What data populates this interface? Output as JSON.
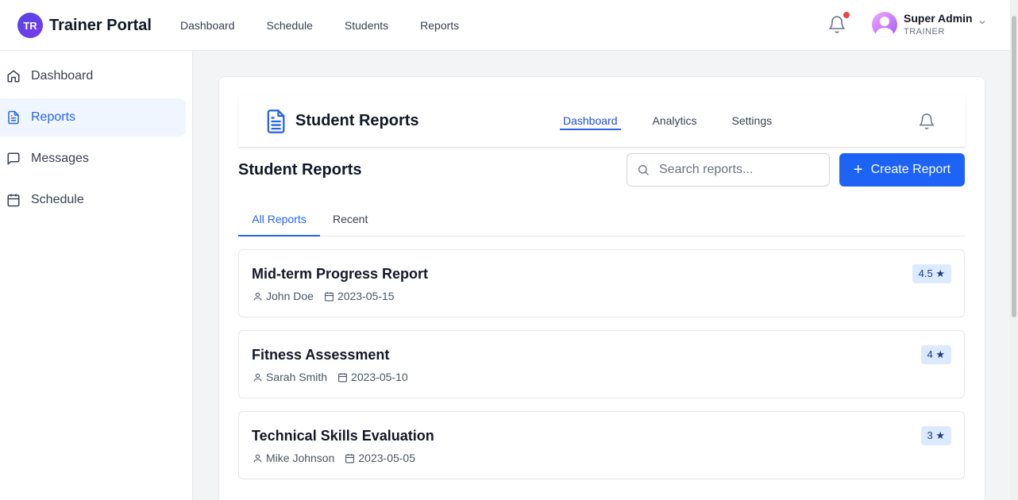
{
  "app": {
    "badge": "TR",
    "title": "Trainer Portal"
  },
  "topnav": [
    "Dashboard",
    "Schedule",
    "Students",
    "Reports"
  ],
  "user": {
    "name": "Super Admin",
    "role": "TRAINER"
  },
  "sidebar": {
    "items": [
      {
        "label": "Dashboard",
        "icon": "home-icon"
      },
      {
        "label": "Reports",
        "icon": "document-icon",
        "active": true
      },
      {
        "label": "Messages",
        "icon": "message-icon"
      },
      {
        "label": "Schedule",
        "icon": "calendar-icon"
      }
    ]
  },
  "inner_header": {
    "title": "Student Reports",
    "nav": [
      "Dashboard",
      "Analytics",
      "Settings"
    ],
    "active_nav": "Dashboard"
  },
  "page": {
    "title": "Student Reports",
    "search_placeholder": "Search reports...",
    "search_value": "",
    "create_plus": "+",
    "create_label": "Create Report"
  },
  "tabs": {
    "all": "All Reports",
    "recent": "Recent",
    "active": "All Reports"
  },
  "reports": [
    {
      "title": "Mid-term Progress Report",
      "student": "John Doe",
      "date": "2023-05-15",
      "rating": "4.5 ★"
    },
    {
      "title": "Fitness Assessment",
      "student": "Sarah Smith",
      "date": "2023-05-10",
      "rating": "4 ★"
    },
    {
      "title": "Technical Skills Evaluation",
      "student": "Mike Johnson",
      "date": "2023-05-05",
      "rating": "3 ★"
    }
  ],
  "colors": {
    "primary": "#1d63f5",
    "notification_dot": "#ef4444",
    "active_bg": "#eff6ff"
  }
}
